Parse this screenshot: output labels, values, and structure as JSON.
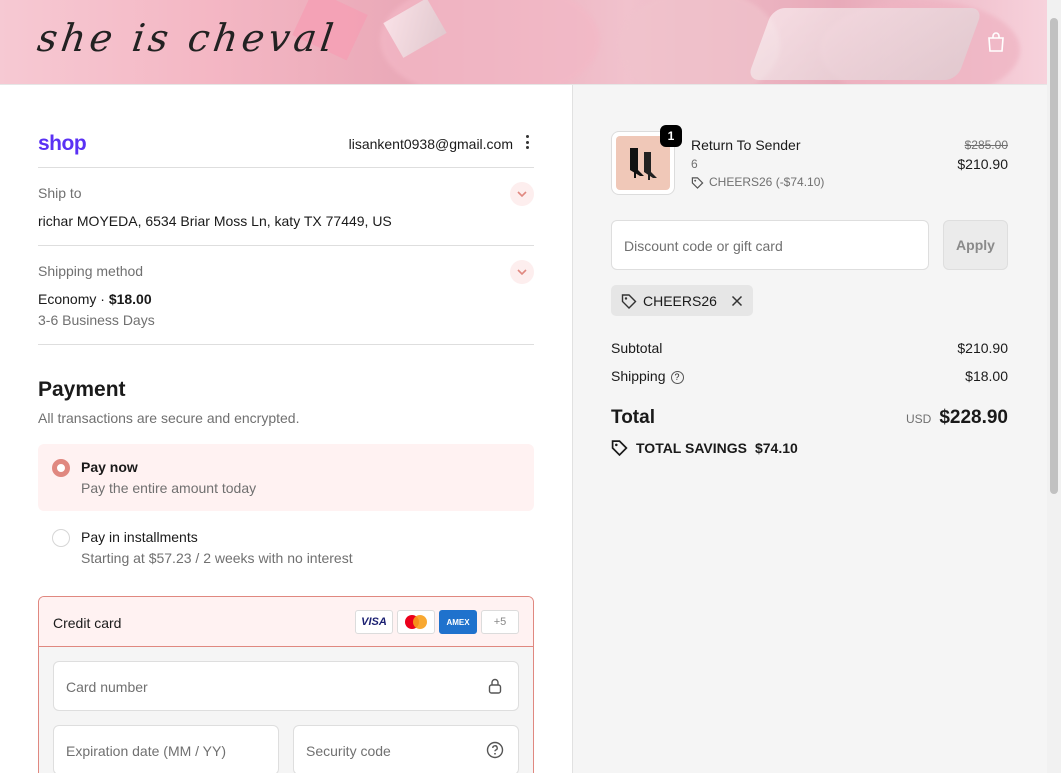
{
  "store": {
    "logo_text": "she is cheval",
    "cart_icon": "shopping-bag-icon"
  },
  "account": {
    "shop_logo": "shop",
    "email": "lisankent0938@gmail.com"
  },
  "ship_to": {
    "label": "Ship to",
    "value": "richar MOYEDA, 6534 Briar Moss Ln, katy TX 77449, US"
  },
  "shipping_method": {
    "label": "Shipping method",
    "name": "Economy",
    "separator": " · ",
    "price": "$18.00",
    "detail": "3-6 Business Days"
  },
  "payment": {
    "title": "Payment",
    "subtitle": "All transactions are secure and encrypted.",
    "options": [
      {
        "title": "Pay now",
        "subtitle": "Pay the entire amount today",
        "selected": true
      },
      {
        "title": "Pay in installments",
        "subtitle": "Starting at $57.23 / 2 weeks with no interest",
        "selected": false
      }
    ],
    "credit_card": {
      "label": "Credit card",
      "brands": [
        "VISA",
        "mastercard",
        "AMEX",
        "+5"
      ],
      "card_number_placeholder": "Card number",
      "expiration_placeholder": "Expiration date (MM / YY)",
      "security_code_placeholder": "Security code"
    }
  },
  "order": {
    "item": {
      "name": "Return To Sender",
      "variant": "6",
      "quantity": "1",
      "discount_label": "CHEERS26 (-$74.10)",
      "original_price": "$285.00",
      "price": "$210.90"
    },
    "discount_placeholder": "Discount code or gift card",
    "apply_label": "Apply",
    "applied_code": "CHEERS26",
    "subtotal_label": "Subtotal",
    "subtotal": "$210.90",
    "shipping_label": "Shipping",
    "shipping": "$18.00",
    "total_label": "Total",
    "currency": "USD",
    "total": "$228.90",
    "savings_label": "TOTAL SAVINGS",
    "savings": "$74.10"
  },
  "colors": {
    "accent": "#e08880",
    "accent_bg": "#fff2f2",
    "shop_purple": "#5a31f4"
  }
}
